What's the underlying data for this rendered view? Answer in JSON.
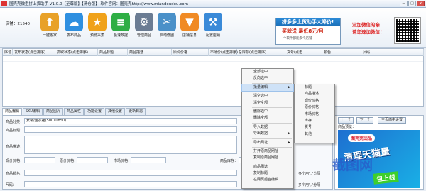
{
  "window": {
    "title": "图壳壳微型拼上货助手 V1.0.0【至尊版】【清仓版】 软件官网：图壳壳http://www.miandoudou.com",
    "minimize": "－",
    "maximize": "□",
    "close": "×"
  },
  "shop": {
    "label": "店铺：21540"
  },
  "toolbar": [
    {
      "label": "一键搬家",
      "icon": "upload-icon",
      "color": "#e8a128",
      "glyph": "⬆"
    },
    {
      "label": "发布商品",
      "icon": "cloud-upload-icon",
      "color": "#2e8fe0",
      "glyph": "☁"
    },
    {
      "label": "预览采集",
      "icon": "star-icon",
      "color": "#f0a21a",
      "glyph": "★"
    },
    {
      "label": "极速数据",
      "icon": "layers-icon",
      "color": "#2eae44",
      "glyph": "≡"
    },
    {
      "label": "管理商品",
      "icon": "gear-icon",
      "color": "#6b7c93",
      "glyph": "⚙"
    },
    {
      "label": "启动修图",
      "icon": "scissors-icon",
      "color": "#4a90c8",
      "glyph": "✂"
    },
    {
      "label": "店铺信息",
      "icon": "bookmark-icon",
      "color": "#f08a24",
      "glyph": "▼"
    },
    {
      "label": "配置店铺",
      "icon": "tools-icon",
      "color": "#3a8ad8",
      "glyph": "⚒"
    }
  ],
  "banner": {
    "head": "拼多多上货助手大降价!",
    "mid": "买就送  最低8元/月",
    "bot": "个软件都能多个店铺"
  },
  "promo": {
    "line1": "没加微信的亲",
    "line2": "请您速加微信！"
  },
  "table": {
    "columns": [
      "序号",
      "发布状态(点击排序)",
      "抓取状态(点击排序)",
      "商品标题",
      "商品描述",
      "原价价格",
      "市场价(点击排序)",
      "总库存(点击排序)",
      "货号(点击",
      "颜色",
      "尺码"
    ]
  },
  "tabs": [
    "商品编辑",
    "SKU编辑",
    "商品图片",
    "商品属性",
    "功能设置",
    "其他设置",
    "更新日志"
  ],
  "editor": {
    "category_label": "商品分类：",
    "category_value": "女装/连衣裙(50010850)",
    "title_label": "商品标题：",
    "desc_label": "商品描述：",
    "price_label": "现价价格：",
    "orig_price_label": "原价价格：",
    "market_price_label": "市场价格：",
    "stock_label": "商品库存：",
    "color_label": "商品颜色：",
    "size_label": "尺码：",
    "hint1": "多个用\",\"分隔",
    "hint2": "多个用\",\"分隔"
  },
  "preview": {
    "prev_button": "上一个",
    "next_button": "下一个",
    "edit_button": "主页面中设置",
    "title": "商品预览：",
    "img_tag": "图壳壳出品",
    "img_main": "清理天猫量",
    "img_bottom": "包上线"
  },
  "watermark": "截图网",
  "context_menu": {
    "items": [
      "全部选中",
      "反向选中",
      "批量编辑",
      "清空选中",
      "清空全部",
      "删除选中",
      "删除全部",
      "导入数据",
      "导出数据",
      "导出网址",
      "打开原商品网址",
      "复制原商品网址",
      "商品图选",
      "复制标题",
      "在网页后台编辑"
    ],
    "submenu_index": 2
  },
  "sub_menu": {
    "items": [
      "标题",
      "商品描述",
      "现价价格",
      "原价价格",
      "市场价格",
      "库存",
      "货号",
      "其他"
    ]
  }
}
